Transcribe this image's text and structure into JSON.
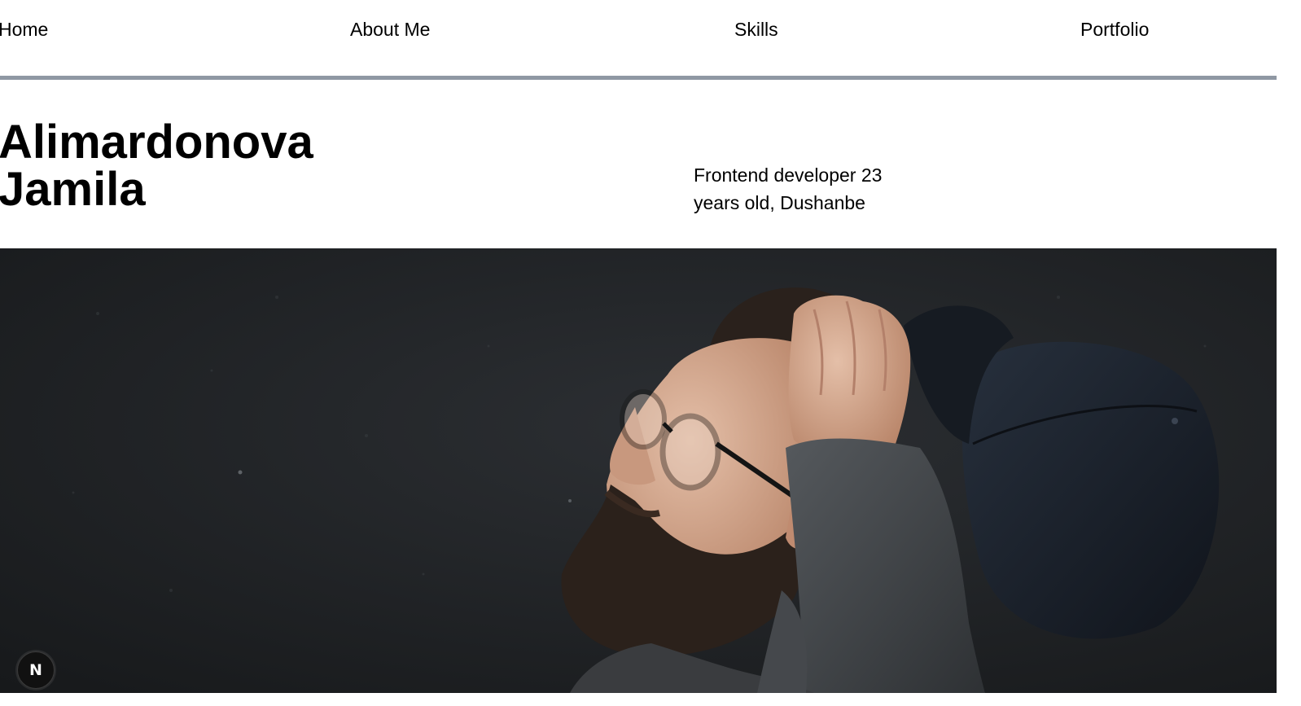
{
  "nav": {
    "items": [
      {
        "label": "Home"
      },
      {
        "label": "About Me"
      },
      {
        "label": "Skills"
      },
      {
        "label": "Portfolio"
      }
    ]
  },
  "hero": {
    "name_line1": "Alimardonova",
    "name_line2": "Jamila",
    "description": "Frontend developer 23 years old, Dushanbe"
  },
  "badge": {
    "letter": "N",
    "icon": "nextjs-logo-icon"
  },
  "colors": {
    "divider": "#8f98a3",
    "photo_background": "#1e2022",
    "badge_background": "#111111"
  }
}
